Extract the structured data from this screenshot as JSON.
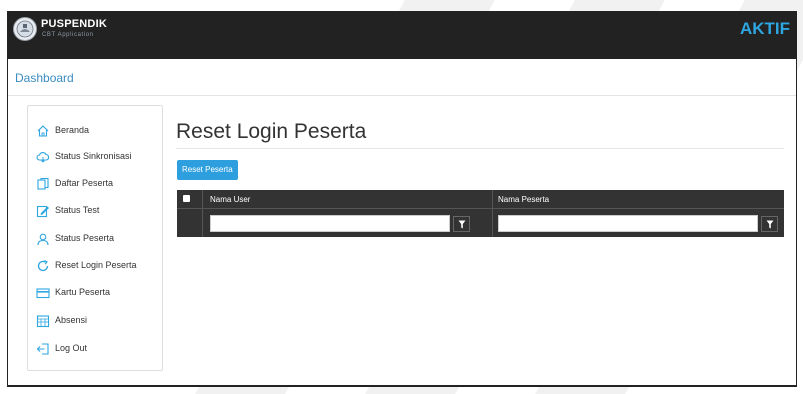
{
  "header": {
    "brand_title": "PUSPENDIK",
    "brand_subtitle": "CBT Application",
    "status": "AKTIF"
  },
  "breadcrumb": {
    "label": "Dashboard"
  },
  "sidebar": {
    "items": [
      {
        "label": "Beranda",
        "icon": "home-icon"
      },
      {
        "label": "Status Sinkronisasi",
        "icon": "cloud-sync-icon"
      },
      {
        "label": "Daftar Peserta",
        "icon": "copy-icon"
      },
      {
        "label": "Status Test",
        "icon": "edit-icon"
      },
      {
        "label": "Status Peserta",
        "icon": "user-icon"
      },
      {
        "label": "Reset Login Peserta",
        "icon": "refresh-icon"
      },
      {
        "label": "Kartu Peserta",
        "icon": "card-icon"
      },
      {
        "label": "Absensi",
        "icon": "calendar-icon"
      },
      {
        "label": "Log Out",
        "icon": "logout-icon"
      }
    ]
  },
  "main": {
    "title": "Reset Login Peserta",
    "reset_button": "Reset Peserta",
    "grid": {
      "columns": [
        "Nama User",
        "Nama Peserta"
      ],
      "filters": [
        {
          "value": "",
          "placeholder": ""
        },
        {
          "value": "",
          "placeholder": ""
        }
      ]
    }
  },
  "colors": {
    "accent": "#2e9fde",
    "header_bg": "#222222",
    "grid_bg": "#333333",
    "breadcrumb": "#3a8cc2"
  }
}
